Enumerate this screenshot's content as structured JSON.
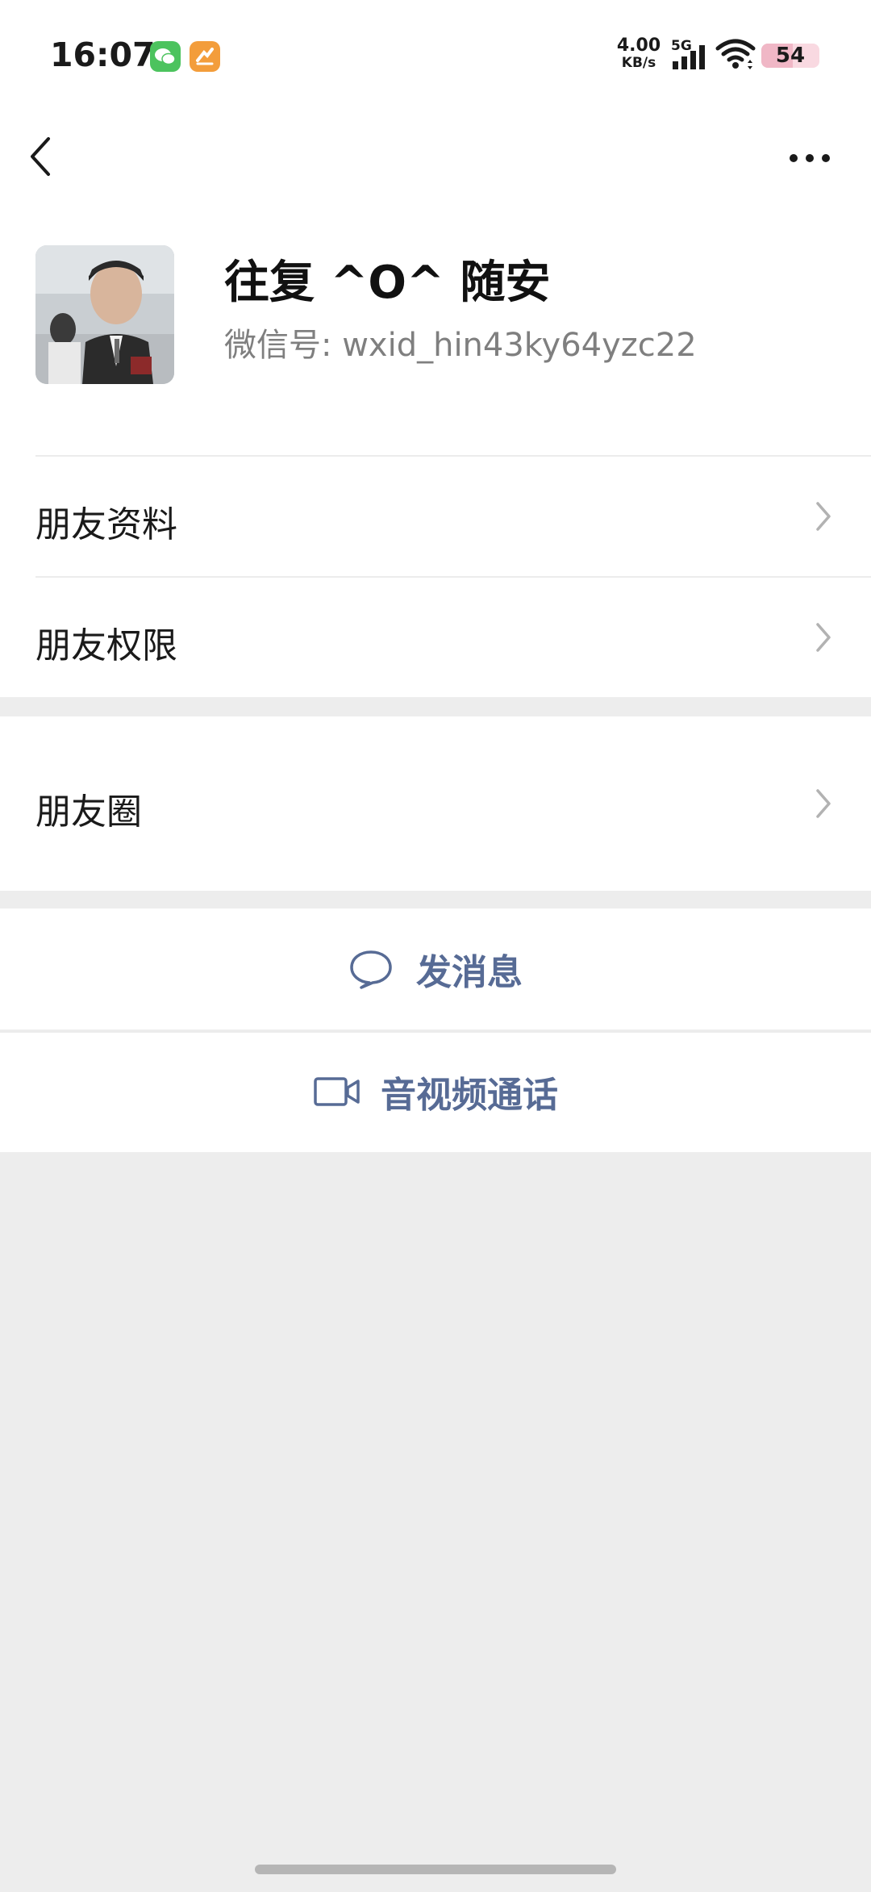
{
  "status_bar": {
    "time": "16:07",
    "net_speed_value": "4.00",
    "net_speed_unit": "KB/s",
    "network_type": "5G",
    "battery_level": "54",
    "battery_fraction": 0.54,
    "app_icons": [
      "wechat-icon",
      "orange-app-icon"
    ]
  },
  "header": {
    "back_icon": "chevron-left-icon",
    "more_icon": "more-dots-icon"
  },
  "profile": {
    "name": "往复 ^O^ 随安",
    "wechat_id_label": "微信号:",
    "wechat_id_value": "wxid_hin43ky64yzc22"
  },
  "menu": {
    "friend_info": "朋友资料",
    "friend_permissions": "朋友权限",
    "moments": "朋友圈"
  },
  "actions": {
    "send_message": "发消息",
    "video_call": "音视频通话"
  },
  "colors": {
    "accent_link": "#576b95",
    "background": "#ededed",
    "card": "#ffffff",
    "battery_bg": "#f9d9e1"
  }
}
